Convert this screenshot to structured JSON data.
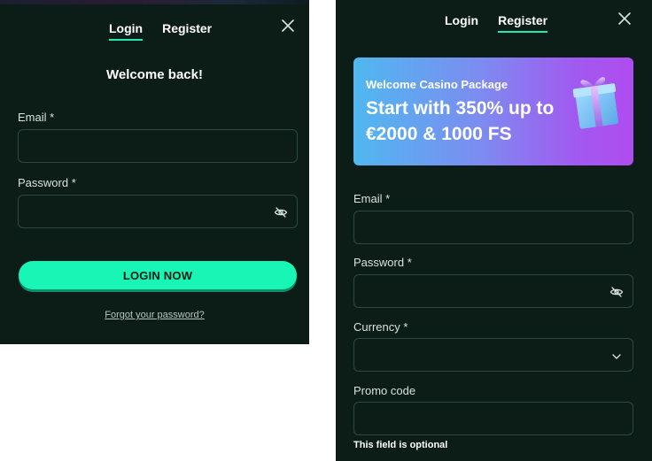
{
  "login_modal": {
    "tabs": [
      {
        "label": "Login",
        "active": true
      },
      {
        "label": "Register",
        "active": false
      }
    ],
    "welcome": "Welcome back!",
    "email_label": "Email *",
    "email_value": "",
    "password_label": "Password *",
    "password_value": "",
    "submit_label": "LOGIN NOW",
    "forgot_link": "Forgot your password?"
  },
  "register_modal": {
    "tabs": [
      {
        "label": "Login",
        "active": false
      },
      {
        "label": "Register",
        "active": true
      }
    ],
    "banner": {
      "kicker": "Welcome Casino Package",
      "headline": "Start with 350% up to €2000 & 1000 FS"
    },
    "email_label": "Email *",
    "email_value": "",
    "password_label": "Password *",
    "password_value": "",
    "currency_label": "Currency *",
    "currency_value": "",
    "promo_label": "Promo code",
    "promo_value": "",
    "promo_hint": "This field is optional"
  },
  "colors": {
    "panel_bg": "#0c1c17",
    "accent": "#19f5b5",
    "field_border": "#2c4a41",
    "banner_start": "#4fb8f0",
    "banner_end": "#b04cf0"
  },
  "icons": [
    "close-icon",
    "eye-off-icon",
    "chevron-down-icon",
    "gift-box-icon"
  ]
}
